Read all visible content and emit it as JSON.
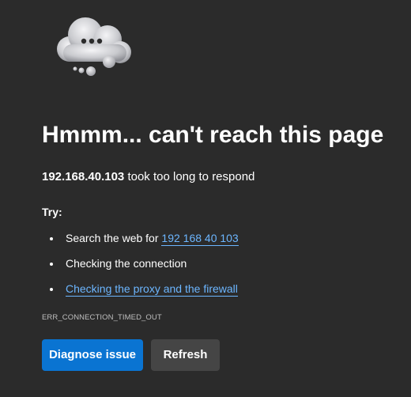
{
  "illustration": {
    "icon": "cloud-thinking-icon"
  },
  "title": "Hmmm... can't reach this page",
  "subtitle": {
    "host": "192.168.40.103",
    "text": " took too long to respond"
  },
  "try_label": "Try:",
  "suggestions": [
    {
      "prefix": "Search the web for ",
      "link": "192 168 40 103"
    },
    {
      "text": "Checking the connection"
    },
    {
      "link": "Checking the proxy and the firewall"
    }
  ],
  "error_code": "ERR_CONNECTION_TIMED_OUT",
  "buttons": {
    "diagnose": "Diagnose issue",
    "refresh": "Refresh"
  },
  "colors": {
    "background": "#2b2b2b",
    "link": "#6cb6ff",
    "primary_button": "#0a74d2",
    "secondary_button": "#454545"
  }
}
